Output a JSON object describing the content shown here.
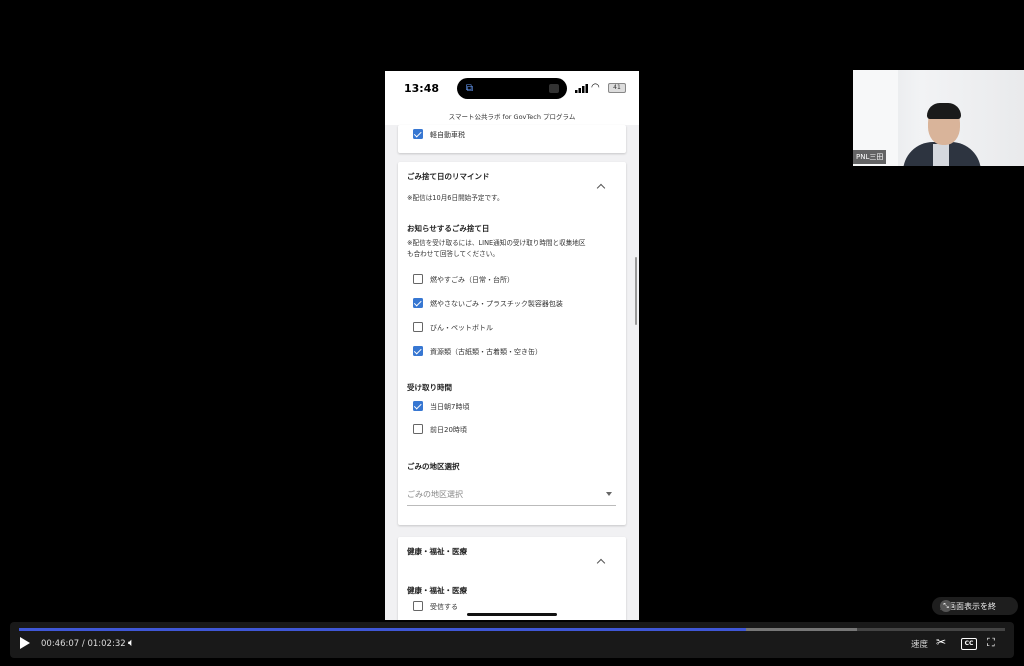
{
  "phone": {
    "status": {
      "time": "13:48",
      "battery": "41"
    },
    "site_title": "スマート公共ラボ for GovTech プログラム",
    "top_item": {
      "label": "軽自動車税",
      "checked": true
    },
    "reminder": {
      "title": "ごみ捨て日のリマインド",
      "note": "※配信は10月6日開始予定です。",
      "days_heading": "お知らせするごみ捨て日",
      "days_note_line1": "※配信を受け取るには、LINE通知の受け取り時間と収集地区",
      "days_note_line2": "も合わせて回答してください。",
      "days": [
        {
          "label": "燃やすごみ（日常・台所）",
          "checked": false
        },
        {
          "label": "燃やさないごみ・プラスチック製容器包装",
          "checked": true
        },
        {
          "label": "びん・ペットボトル",
          "checked": false
        },
        {
          "label": "資源類（古紙類・古着類・空き缶）",
          "checked": true
        }
      ],
      "time_heading": "受け取り時間",
      "times": [
        {
          "label": "当日朝7時頃",
          "checked": true
        },
        {
          "label": "前日20時頃",
          "checked": false
        }
      ],
      "area_heading": "ごみの地区選択",
      "area_placeholder": "ごみの地区選択"
    },
    "health": {
      "title": "健康・福祉・医療",
      "sub_heading": "健康・福祉・医療",
      "option": {
        "label": "受信する",
        "checked": false
      }
    }
  },
  "webcam": {
    "name": "PNL三田"
  },
  "tooltip": {
    "text": "全画面表示を終"
  },
  "player": {
    "current_time": "00:46:07",
    "separator": "/",
    "duration": "01:02:32",
    "progress": 0.7376,
    "buffered": 0.85,
    "speed_label": "速度",
    "cc_label": "CC"
  },
  "icons": [
    "play-icon",
    "volume-icon",
    "scissors-icon",
    "cc-icon",
    "exit-fullscreen-icon",
    "chevron-up-icon",
    "dropdown-arrow-icon",
    "wifi-icon",
    "signal-icon",
    "battery-icon"
  ]
}
